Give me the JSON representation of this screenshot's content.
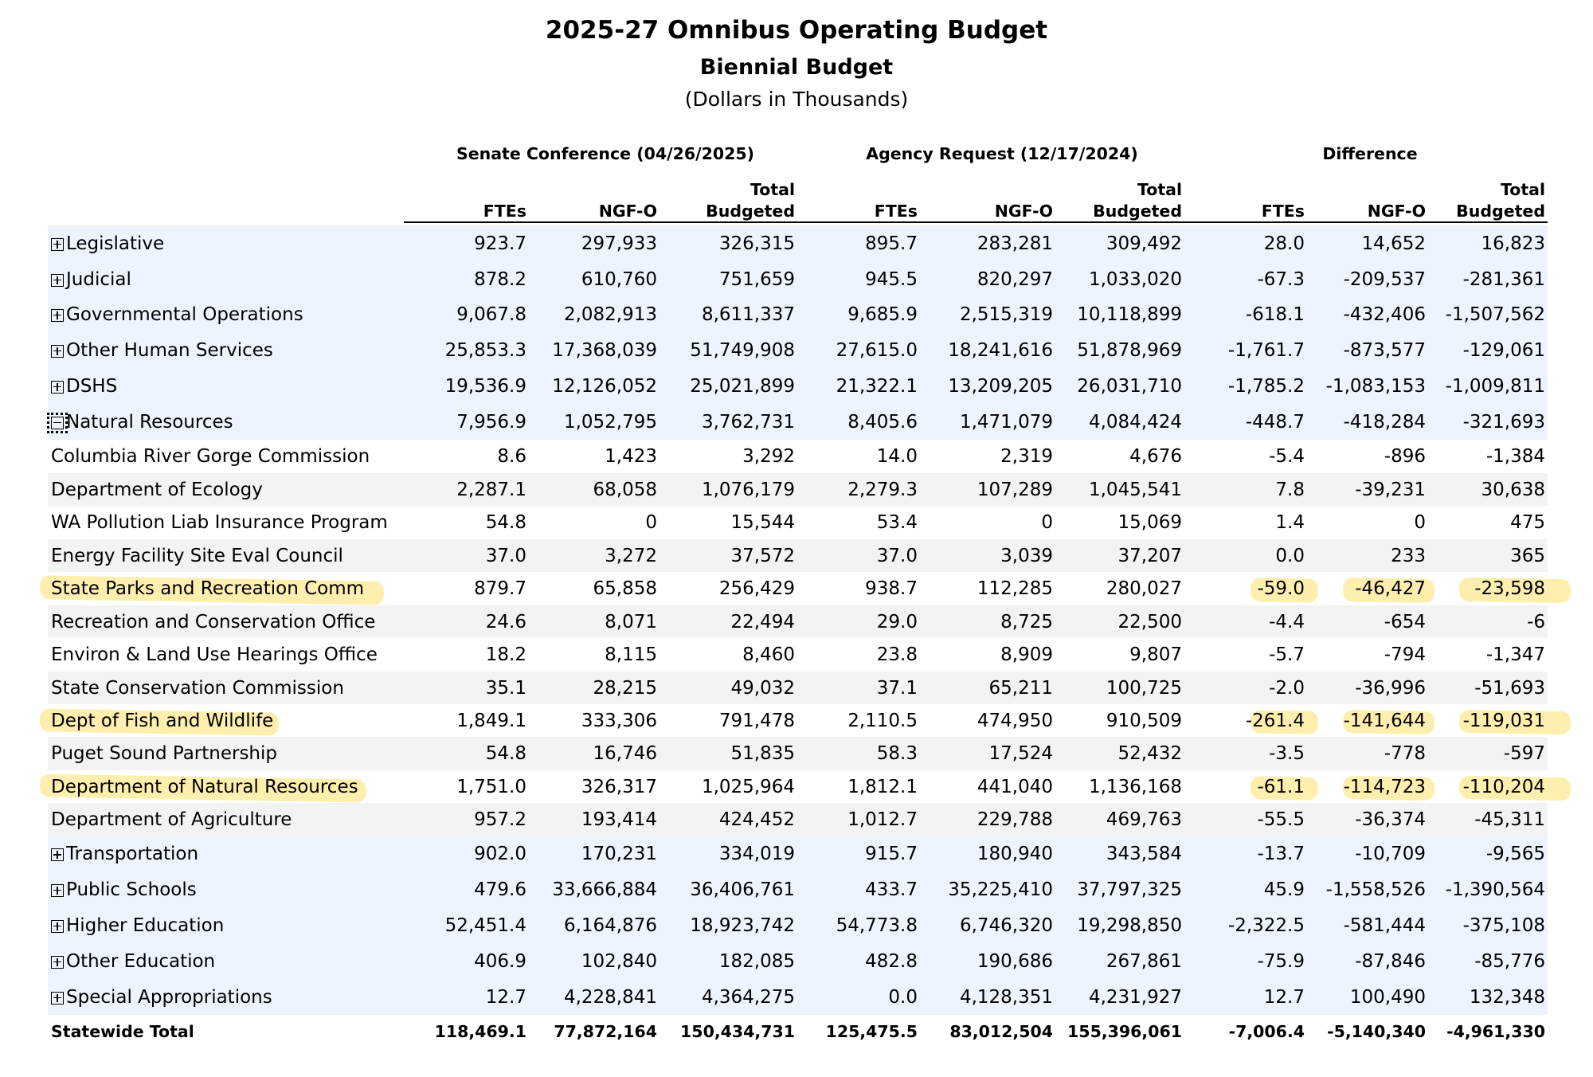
{
  "title": "2025-27 Omnibus Operating Budget",
  "subtitle": "Biennial Budget",
  "units": "(Dollars in Thousands)",
  "groups": [
    "Senate Conference (04/26/2025)",
    "Agency Request (12/17/2024)",
    "Difference"
  ],
  "col_headers": [
    {
      "l1": "",
      "l2": "FTEs"
    },
    {
      "l1": "",
      "l2": "NGF-O"
    },
    {
      "l1": "Total",
      "l2": "Budgeted"
    },
    {
      "l1": "",
      "l2": "FTEs"
    },
    {
      "l1": "",
      "l2": "NGF-O"
    },
    {
      "l1": "Total",
      "l2": "Budgeted"
    },
    {
      "l1": "",
      "l2": "FTEs"
    },
    {
      "l1": "",
      "l2": "NGF-O"
    },
    {
      "l1": "Total",
      "l2": "Budgeted"
    }
  ],
  "highlight_color": "#ffe26e",
  "rows": [
    {
      "name": "Legislative",
      "expander": "plus",
      "values": [
        "923.7",
        "297,933",
        "326,315",
        "895.7",
        "283,281",
        "309,492",
        "28.0",
        "14,652",
        "16,823"
      ]
    },
    {
      "name": "Judicial",
      "expander": "plus",
      "values": [
        "878.2",
        "610,760",
        "751,659",
        "945.5",
        "820,297",
        "1,033,020",
        "-67.3",
        "-209,537",
        "-281,361"
      ]
    },
    {
      "name": "Governmental Operations",
      "expander": "plus",
      "values": [
        "9,067.8",
        "2,082,913",
        "8,611,337",
        "9,685.9",
        "2,515,319",
        "10,118,899",
        "-618.1",
        "-432,406",
        "-1,507,562"
      ]
    },
    {
      "name": "Other Human Services",
      "expander": "plus",
      "values": [
        "25,853.3",
        "17,368,039",
        "51,749,908",
        "27,615.0",
        "18,241,616",
        "51,878,969",
        "-1,761.7",
        "-873,577",
        "-129,061"
      ]
    },
    {
      "name": "DSHS",
      "expander": "plus",
      "values": [
        "19,536.9",
        "12,126,052",
        "25,021,899",
        "21,322.1",
        "13,209,205",
        "26,031,710",
        "-1,785.2",
        "-1,083,153",
        "-1,009,811"
      ]
    },
    {
      "name": "Natural Resources",
      "expander": "minus",
      "values": [
        "7,956.9",
        "1,052,795",
        "3,762,731",
        "8,405.6",
        "1,471,079",
        "4,084,424",
        "-448.7",
        "-418,284",
        "-321,693"
      ]
    },
    {
      "name": "Columbia River Gorge Commission",
      "expander": "",
      "values": [
        "8.6",
        "1,423",
        "3,292",
        "14.0",
        "2,319",
        "4,676",
        "-5.4",
        "-896",
        "-1,384"
      ]
    },
    {
      "name": "Department of Ecology",
      "expander": "",
      "values": [
        "2,287.1",
        "68,058",
        "1,076,179",
        "2,279.3",
        "107,289",
        "1,045,541",
        "7.8",
        "-39,231",
        "30,638"
      ]
    },
    {
      "name": "WA Pollution Liab Insurance Program",
      "expander": "",
      "values": [
        "54.8",
        "0",
        "15,544",
        "53.4",
        "0",
        "15,069",
        "1.4",
        "0",
        "475"
      ]
    },
    {
      "name": "Energy Facility Site Eval Council",
      "expander": "",
      "values": [
        "37.0",
        "3,272",
        "37,572",
        "37.0",
        "3,039",
        "37,207",
        "0.0",
        "233",
        "365"
      ]
    },
    {
      "name": "State Parks and Recreation Comm",
      "expander": "",
      "highlight": true,
      "values": [
        "879.7",
        "65,858",
        "256,429",
        "938.7",
        "112,285",
        "280,027",
        "-59.0",
        "-46,427",
        "-23,598"
      ]
    },
    {
      "name": "Recreation and Conservation Office",
      "expander": "",
      "values": [
        "24.6",
        "8,071",
        "22,494",
        "29.0",
        "8,725",
        "22,500",
        "-4.4",
        "-654",
        "-6"
      ]
    },
    {
      "name": "Environ & Land Use Hearings Office",
      "expander": "",
      "values": [
        "18.2",
        "8,115",
        "8,460",
        "23.8",
        "8,909",
        "9,807",
        "-5.7",
        "-794",
        "-1,347"
      ]
    },
    {
      "name": "State Conservation Commission",
      "expander": "",
      "values": [
        "35.1",
        "28,215",
        "49,032",
        "37.1",
        "65,211",
        "100,725",
        "-2.0",
        "-36,996",
        "-51,693"
      ]
    },
    {
      "name": "Dept of Fish and Wildlife",
      "expander": "",
      "highlight": true,
      "values": [
        "1,849.1",
        "333,306",
        "791,478",
        "2,110.5",
        "474,950",
        "910,509",
        "-261.4",
        "-141,644",
        "-119,031"
      ]
    },
    {
      "name": "Puget Sound Partnership",
      "expander": "",
      "values": [
        "54.8",
        "16,746",
        "51,835",
        "58.3",
        "17,524",
        "52,432",
        "-3.5",
        "-778",
        "-597"
      ]
    },
    {
      "name": "Department of Natural Resources",
      "expander": "",
      "highlight": true,
      "values": [
        "1,751.0",
        "326,317",
        "1,025,964",
        "1,812.1",
        "441,040",
        "1,136,168",
        "-61.1",
        "-114,723",
        "-110,204"
      ]
    },
    {
      "name": "Department of Agriculture",
      "expander": "",
      "values": [
        "957.2",
        "193,414",
        "424,452",
        "1,012.7",
        "229,788",
        "469,763",
        "-55.5",
        "-36,374",
        "-45,311"
      ]
    },
    {
      "name": "Transportation",
      "expander": "plus",
      "values": [
        "902.0",
        "170,231",
        "334,019",
        "915.7",
        "180,940",
        "343,584",
        "-13.7",
        "-10,709",
        "-9,565"
      ]
    },
    {
      "name": "Public Schools",
      "expander": "plus",
      "values": [
        "479.6",
        "33,666,884",
        "36,406,761",
        "433.7",
        "35,225,410",
        "37,797,325",
        "45.9",
        "-1,558,526",
        "-1,390,564"
      ]
    },
    {
      "name": "Higher Education",
      "expander": "plus",
      "values": [
        "52,451.4",
        "6,164,876",
        "18,923,742",
        "54,773.8",
        "6,746,320",
        "19,298,850",
        "-2,322.5",
        "-581,444",
        "-375,108"
      ]
    },
    {
      "name": "Other Education",
      "expander": "plus",
      "values": [
        "406.9",
        "102,840",
        "182,085",
        "482.8",
        "190,686",
        "267,861",
        "-75.9",
        "-87,846",
        "-85,776"
      ]
    },
    {
      "name": "Special Appropriations",
      "expander": "plus",
      "values": [
        "12.7",
        "4,228,841",
        "4,364,275",
        "0.0",
        "4,128,351",
        "4,231,927",
        "12.7",
        "100,490",
        "132,348"
      ]
    }
  ],
  "total": {
    "name": "Statewide Total",
    "values": [
      "118,469.1",
      "77,872,164",
      "150,434,731",
      "125,475.5",
      "83,012,504",
      "155,396,061",
      "-7,006.4",
      "-5,140,340",
      "-4,961,330"
    ]
  }
}
